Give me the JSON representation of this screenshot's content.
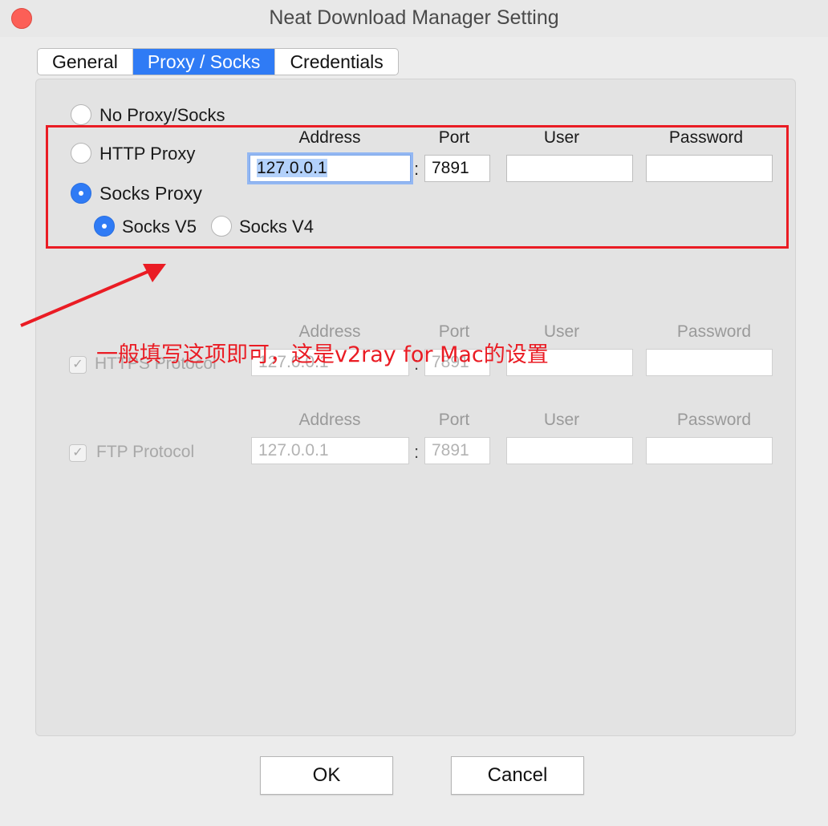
{
  "window": {
    "title": "Neat Download Manager Setting"
  },
  "tabs": [
    {
      "label": "General",
      "active": false
    },
    {
      "label": "Proxy / Socks",
      "active": true
    },
    {
      "label": "Credentials",
      "active": false
    }
  ],
  "proxy_modes": {
    "no_proxy": "No Proxy/Socks",
    "http": "HTTP Proxy",
    "socks": "Socks Proxy",
    "selected": "socks"
  },
  "socks_versions": {
    "v5": "Socks V5",
    "v4": "Socks V4",
    "selected": "v5"
  },
  "headers": {
    "address": "Address",
    "port": "Port",
    "user": "User",
    "password": "Password"
  },
  "main_proxy": {
    "address": "127.0.0.1",
    "port": "7891",
    "user": "",
    "password": ""
  },
  "https_protocol": {
    "label": "HTTPS Protocol",
    "checked": true,
    "enabled": false,
    "address": "127.0.0.1",
    "port": "7891",
    "user": "",
    "password": ""
  },
  "ftp_protocol": {
    "label": "FTP Protocol",
    "checked": true,
    "enabled": false,
    "address": "127.0.0.1",
    "port": "7891",
    "user": "",
    "password": ""
  },
  "annotation": {
    "text": "一般填写这项即可，这是v2ray for Mac的设置",
    "color": "#ea1c24"
  },
  "buttons": {
    "ok": "OK",
    "cancel": "Cancel"
  },
  "colors": {
    "accent": "#2f7bf5",
    "annotation": "#ea1c24",
    "close": "#fc5f57"
  }
}
